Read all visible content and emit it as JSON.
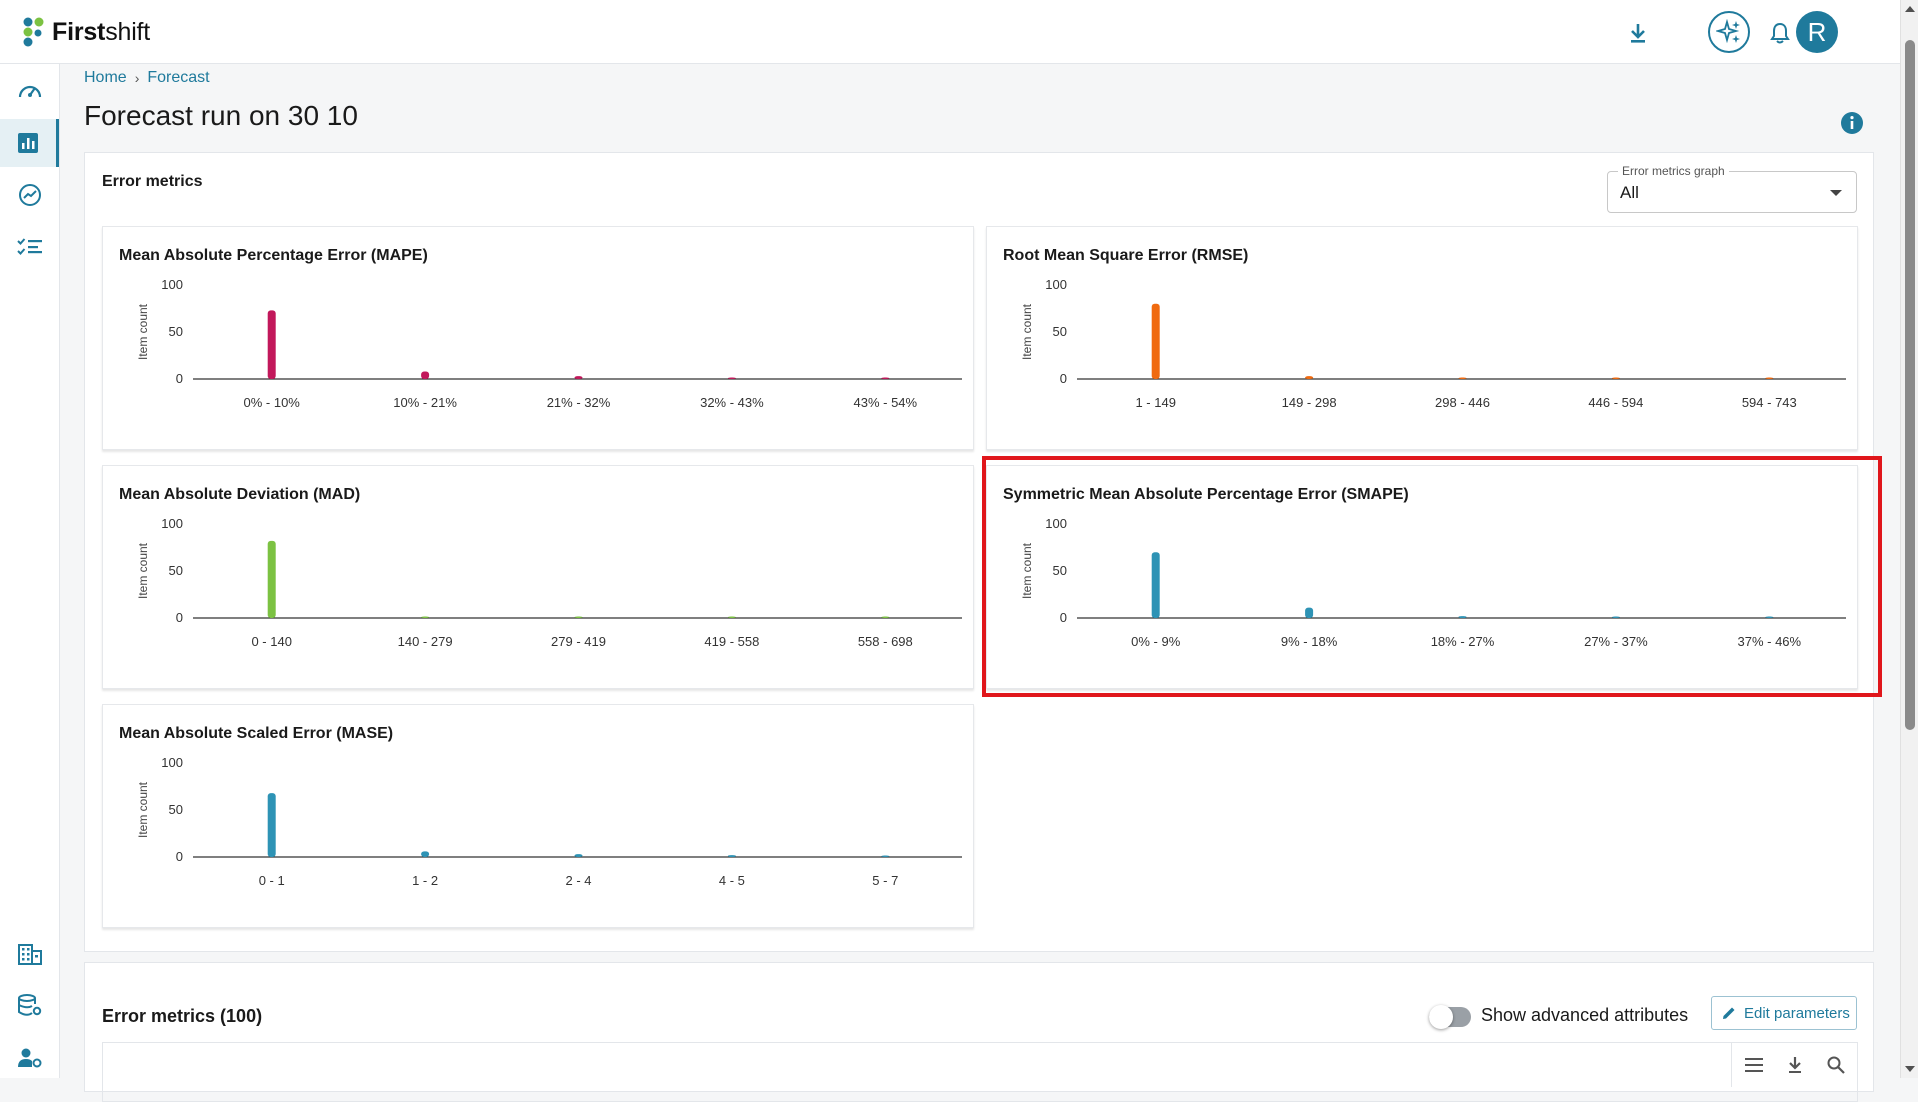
{
  "app": {
    "name_bold": "First",
    "name_rest": "shift",
    "avatar_initial": "R"
  },
  "breadcrumb": {
    "home": "Home",
    "sep": "›",
    "current": "Forecast"
  },
  "page": {
    "title": "Forecast run on 30 10"
  },
  "error_metrics": {
    "title": "Error metrics",
    "select": {
      "label": "Error metrics graph",
      "value": "All"
    }
  },
  "charts": {
    "mape": {
      "title": "Mean Absolute Percentage Error (MAPE)"
    },
    "rmse": {
      "title": "Root Mean Square Error (RMSE)"
    },
    "mad": {
      "title": "Mean Absolute Deviation (MAD)"
    },
    "smape": {
      "title": "Symmetric Mean Absolute Percentage Error (SMAPE)"
    },
    "mase": {
      "title": "Mean Absolute Scaled Error (MASE)"
    }
  },
  "chart_data": [
    {
      "id": "mape",
      "type": "bar",
      "title": "Mean Absolute Percentage Error (MAPE)",
      "ylabel": "Item count",
      "ylim": [
        0,
        100
      ],
      "yticks": [
        0,
        50,
        100
      ],
      "color": "#c2185b",
      "categories": [
        "0% - 10%",
        "10% - 21%",
        "21% - 32%",
        "32% - 43%",
        "43% - 54%"
      ],
      "values": [
        73,
        8,
        3,
        0,
        1
      ]
    },
    {
      "id": "rmse",
      "type": "bar",
      "title": "Root Mean Square Error (RMSE)",
      "ylabel": "Item count",
      "ylim": [
        0,
        100
      ],
      "yticks": [
        0,
        50,
        100
      ],
      "color": "#f06a0f",
      "categories": [
        "1 - 149",
        "149 - 298",
        "298 - 446",
        "446 - 594",
        "594 - 743"
      ],
      "values": [
        80,
        3,
        0,
        1,
        1
      ]
    },
    {
      "id": "mad",
      "type": "bar",
      "title": "Mean Absolute Deviation (MAD)",
      "ylabel": "Item count",
      "ylim": [
        0,
        100
      ],
      "yticks": [
        0,
        50,
        100
      ],
      "color": "#7cc242",
      "categories": [
        "0 - 140",
        "140 - 279",
        "279 - 419",
        "419 - 558",
        "558 - 698"
      ],
      "values": [
        82,
        1,
        0,
        1,
        1
      ]
    },
    {
      "id": "smape",
      "type": "bar",
      "title": "Symmetric Mean Absolute Percentage Error (SMAPE)",
      "ylabel": "Item count",
      "ylim": [
        0,
        100
      ],
      "yticks": [
        0,
        50,
        100
      ],
      "color": "#2e93b5",
      "categories": [
        "0% - 9%",
        "9% - 18%",
        "18% - 27%",
        "27% - 37%",
        "37% - 46%"
      ],
      "values": [
        70,
        11,
        2,
        1,
        1
      ]
    },
    {
      "id": "mase",
      "type": "bar",
      "title": "Mean Absolute Scaled Error (MASE)",
      "ylabel": "Item count",
      "ylim": [
        0,
        100
      ],
      "yticks": [
        0,
        50,
        100
      ],
      "color": "#2e93b5",
      "categories": [
        "0 - 1",
        "1 - 2",
        "2 - 4",
        "4 - 5",
        "5 - 7"
      ],
      "values": [
        68,
        6,
        3,
        2,
        0
      ]
    }
  ],
  "metrics_table": {
    "title": "Error metrics (100)",
    "toggle_label": "Show advanced attributes",
    "edit_button": "Edit parameters"
  },
  "colors": {
    "accent": "#1f7a9c",
    "highlight": "#e0161b"
  },
  "icons": {
    "topbar": [
      "download-icon",
      "ai-sparkle-icon",
      "bell-icon"
    ],
    "sidenav": [
      "speedometer-icon",
      "bar-chart-icon",
      "trend-icon",
      "checklist-icon",
      "building-icon",
      "database-settings-icon",
      "user-settings-icon"
    ],
    "grid": [
      "columns-icon",
      "download-icon",
      "search-icon"
    ]
  }
}
